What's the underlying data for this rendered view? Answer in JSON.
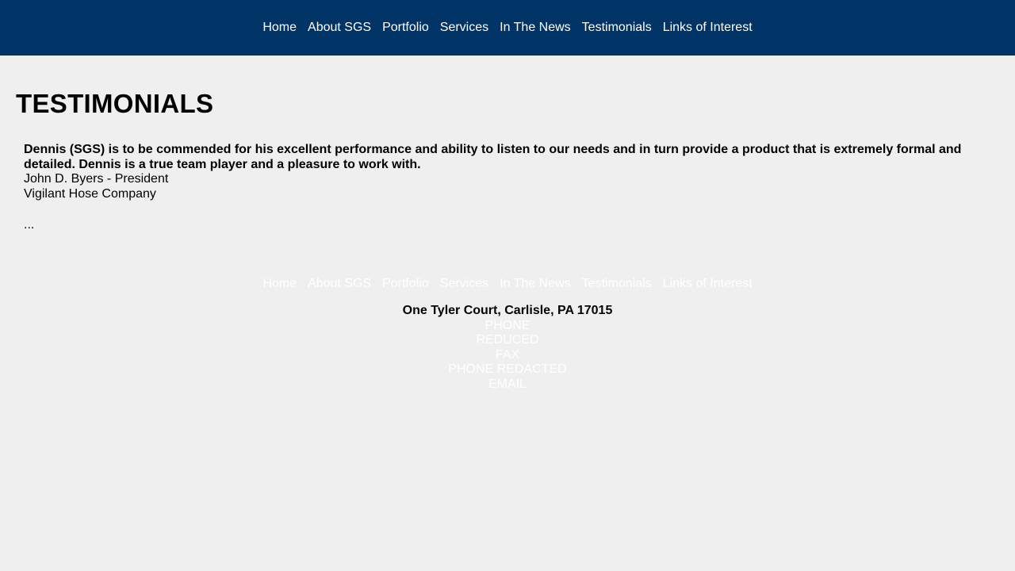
{
  "header": {
    "nav": [
      {
        "label": "Home"
      },
      {
        "label": "About SGS"
      },
      {
        "label": "Portfolio"
      },
      {
        "label": "Services"
      },
      {
        "label": "In The News"
      },
      {
        "label": "Testimonials"
      },
      {
        "label": "Links of Interest"
      }
    ],
    "background_color": "#003366"
  },
  "main": {
    "title": "TESTIMONIALS",
    "testimonial": {
      "quote": "Dennis (SGS) is to be commended for his excellent performance and ability to listen to our needs and in turn provide a product that is extremely formal and detailed. Dennis is a true team player and a pleasure to work with.",
      "author": "John D. Byers - President",
      "organization": "Vigilant Hose Company"
    },
    "ellipsis": "..."
  },
  "footer": {
    "nav": [
      {
        "label": "Home"
      },
      {
        "label": "About SGS"
      },
      {
        "label": "Portfolio"
      },
      {
        "label": "Services"
      },
      {
        "label": "In The News"
      },
      {
        "label": "Testimonials"
      },
      {
        "label": "Links of Interest"
      }
    ],
    "address": "One Tyler Court, Carlisle, PA 17015",
    "phone_label": "PHONE",
    "phone_value": "REDUCED",
    "fax_label": "FAX",
    "fax_value": "PHONE REDACTED",
    "email_label": "EMAIL"
  }
}
